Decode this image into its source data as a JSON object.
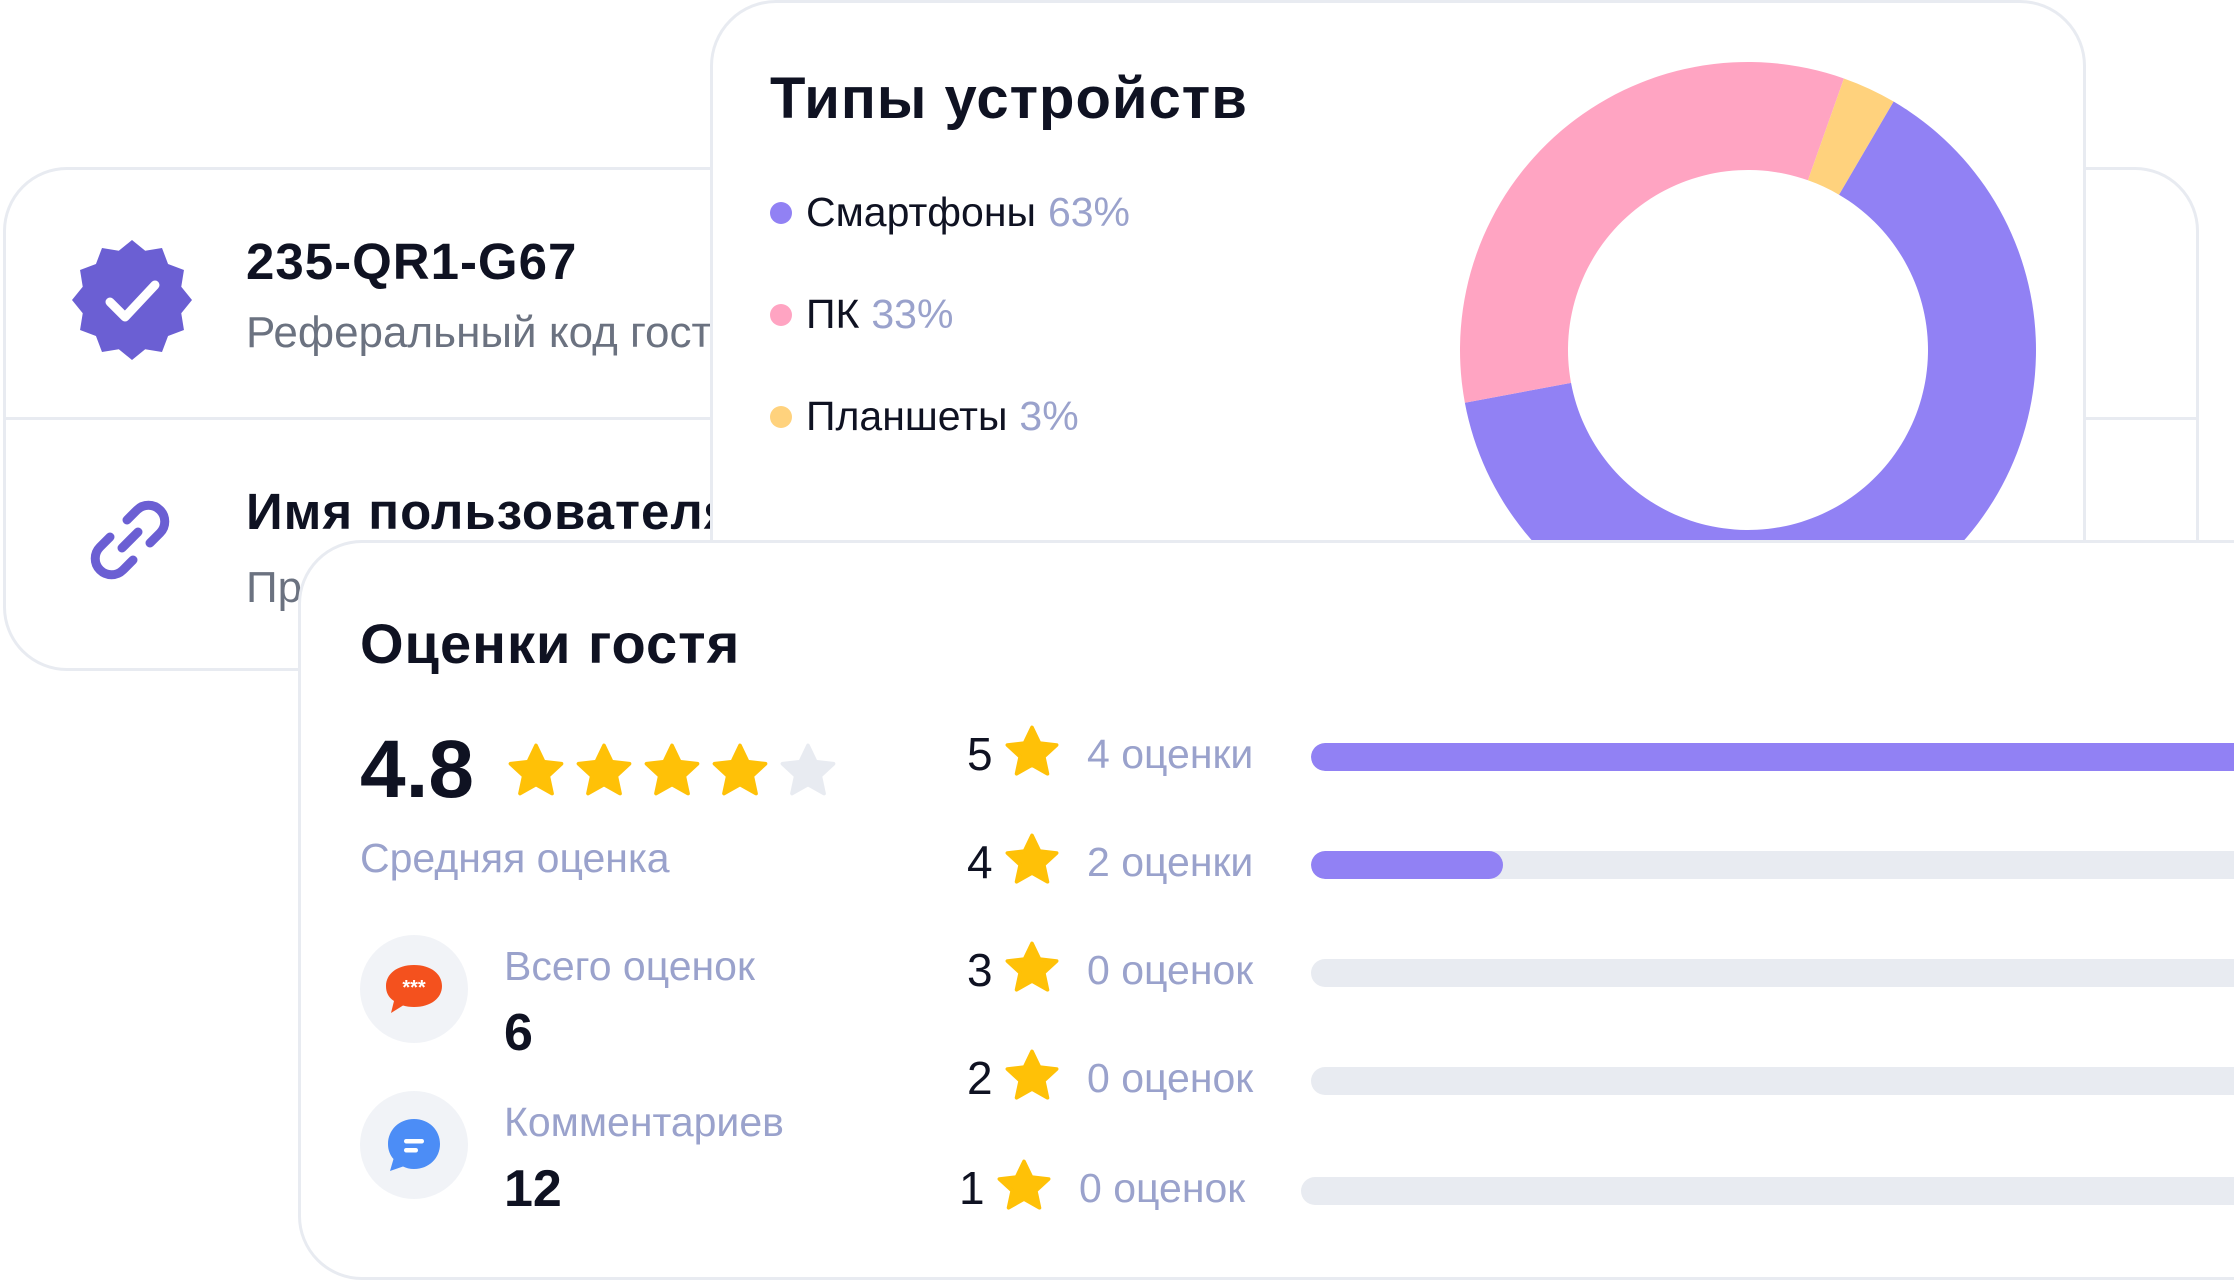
{
  "colors": {
    "accent_purple": "#9181f4",
    "pink": "#ffa4c2",
    "yellow": "#ffd27d",
    "muted_text": "#9aa2cc",
    "track": "#e8ebf1",
    "star": "#ffc107",
    "star_empty": "#e8ebf1",
    "icon_purple": "#6b5fd3"
  },
  "referral_card": {
    "code": "235-QR1-G67",
    "code_caption": "Реферальный код гостя",
    "username_title": "Имя пользователя",
    "username_caption": "Пр",
    "icons": [
      "verified-badge-icon",
      "link-icon"
    ]
  },
  "devices_card": {
    "title": "Типы устройств",
    "legend": [
      {
        "label": "Смартфоны",
        "percent": "63%",
        "color": "#9181f4"
      },
      {
        "label": "ПК",
        "percent": "33%",
        "color": "#ffa4c2"
      },
      {
        "label": "Планшеты",
        "percent": "3%",
        "color": "#ffd27d"
      }
    ]
  },
  "ratings_card": {
    "title": "Оценки гостя",
    "average": "4.8",
    "average_stars": 4,
    "average_label": "Средняя оценка",
    "total_label": "Всего оценок",
    "total_value": "6",
    "comments_label": "Комментариев",
    "comments_value": "12",
    "distribution": [
      {
        "stars": "5",
        "count_label": "4 оценки",
        "fraction": 1.0
      },
      {
        "stars": "4",
        "count_label": "2 оценки",
        "fraction": 0.16
      },
      {
        "stars": "3",
        "count_label": "0 оценок",
        "fraction": 0
      },
      {
        "stars": "2",
        "count_label": "0 оценок",
        "fraction": 0
      },
      {
        "stars": "1",
        "count_label": "0 оценок",
        "fraction": 0
      }
    ]
  },
  "chart_data": {
    "type": "pie",
    "title": "Типы устройств",
    "categories": [
      "Смартфоны",
      "ПК",
      "Планшеты"
    ],
    "values": [
      63,
      33,
      3
    ],
    "colors": [
      "#9181f4",
      "#ffa4c2",
      "#ffd27d"
    ]
  }
}
